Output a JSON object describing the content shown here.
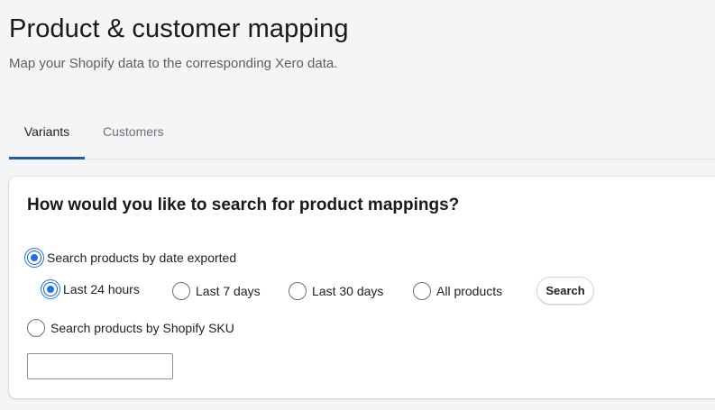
{
  "header": {
    "title": "Product & customer mapping",
    "subtitle": "Map your Shopify data to the corresponding Xero data."
  },
  "tabs": [
    {
      "label": "Variants",
      "active": true
    },
    {
      "label": "Customers",
      "active": false
    }
  ],
  "card": {
    "title": "How would you like to search for product mappings?",
    "option_date": {
      "label": "Search products by date exported",
      "checked": true
    },
    "ranges": [
      {
        "label": "Last 24 hours",
        "checked": true
      },
      {
        "label": "Last 7 days",
        "checked": false
      },
      {
        "label": "Last 30 days",
        "checked": false
      },
      {
        "label": "All products",
        "checked": false
      }
    ],
    "search_label": "Search",
    "option_sku": {
      "label": "Search products by Shopify SKU",
      "checked": false
    },
    "sku_input": {
      "value": "",
      "placeholder": ""
    }
  },
  "colors": {
    "accent": "#1a73e8",
    "tab_underline": "#1f5ea8",
    "background": "#f4f5f6"
  }
}
